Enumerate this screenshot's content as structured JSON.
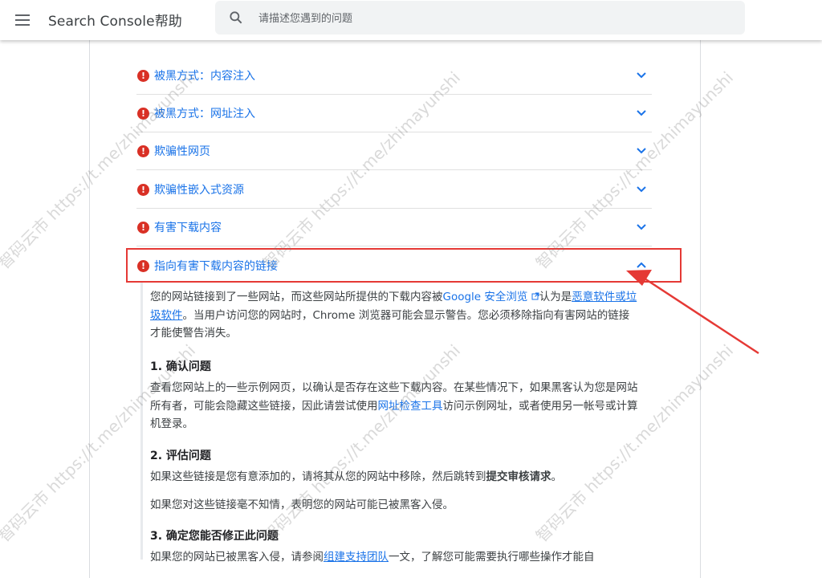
{
  "header": {
    "title": "Search Console帮助",
    "search_placeholder": "请描述您遇到的问题"
  },
  "accordion": {
    "items": [
      {
        "label": "被黑方式：内容注入"
      },
      {
        "label": "被黑方式：网址注入"
      },
      {
        "label": "欺骗性网页"
      },
      {
        "label": "欺骗性嵌入式资源"
      },
      {
        "label": "有害下载内容"
      },
      {
        "label": "指向有害下载内容的链接",
        "expanded": true
      }
    ]
  },
  "expanded_content": {
    "intro_1": "您的网站链接到了一些网站，而这些网站所提供的下载内容被",
    "intro_link_1": "Google 安全浏览",
    "intro_2": "认为是",
    "intro_link_2": "恶意软件或垃圾软件",
    "intro_3": "。当用户访问您的网站时，Chrome 浏览器可能会显示警告。您必须移除指向有害网站的链接才能使警告消失。",
    "step1_title": "1. 确认问题",
    "step1_text_1": "查看您网站上的一些示例网页，以确认是否存在这些下载内容。在某些情况下，如果黑客认为您是网站所有者，可能会隐藏这些链接，因此请尝试使用",
    "step1_link": "网址检查工具",
    "step1_text_2": "访问示例网址，或者使用另一帐号或计算机登录。",
    "step2_title": "2. 评估问题",
    "step2_text_1": "如果这些链接是您有意添加的，请将其从您的网站中移除，然后跳转到",
    "step2_bold": "提交审核请求",
    "step2_text_2": "。",
    "step2_text_3": "如果您对这些链接毫不知情，表明您的网站可能已被黑客入侵。",
    "step3_title": "3. 确定您能否修正此问题",
    "step3_text_1": "如果您的网站已被黑客入侵，请参阅",
    "step3_link": "组建支持团队",
    "step3_text_2": "一文，了解您可能需要执行哪些操作才能自"
  },
  "watermark": {
    "text": "智码云市 https://t.me/zhimayunshi"
  },
  "colors": {
    "link": "#1a73e8",
    "error": "#d93025",
    "highlight_border": "#e53935"
  }
}
